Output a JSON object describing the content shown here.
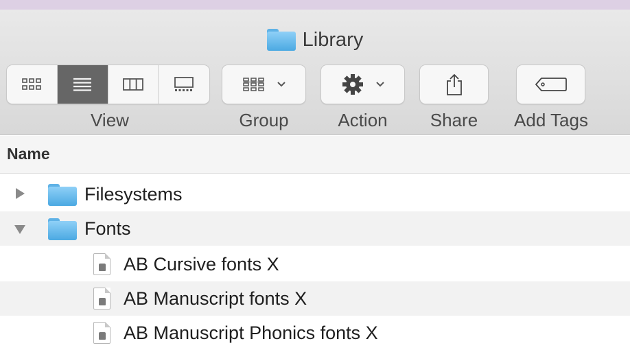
{
  "window": {
    "title": "Library",
    "title_icon": "folder-icon"
  },
  "toolbar": {
    "view": {
      "label": "View",
      "modes": [
        {
          "name": "icon-view",
          "icon": "grid-icon",
          "active": false
        },
        {
          "name": "list-view",
          "icon": "list-icon",
          "active": true
        },
        {
          "name": "column-view",
          "icon": "columns-icon",
          "active": false
        },
        {
          "name": "gallery-view",
          "icon": "gallery-icon",
          "active": false
        }
      ]
    },
    "group": {
      "label": "Group",
      "icon": "group-grid-icon"
    },
    "action": {
      "label": "Action",
      "icon": "gear-icon"
    },
    "share": {
      "label": "Share",
      "icon": "share-icon"
    },
    "add_tags": {
      "label": "Add Tags",
      "icon": "tag-icon"
    }
  },
  "list": {
    "column_header": "Name",
    "rows": [
      {
        "name": "Filesystems",
        "kind": "folder",
        "expanded": false,
        "depth": 0
      },
      {
        "name": "Fonts",
        "kind": "folder",
        "expanded": true,
        "depth": 0
      },
      {
        "name": "AB Cursive fonts X",
        "kind": "document",
        "depth": 1
      },
      {
        "name": "AB Manuscript fonts X",
        "kind": "document",
        "depth": 1
      },
      {
        "name": "AB Manuscript Phonics fonts X",
        "kind": "document",
        "depth": 1
      }
    ]
  },
  "colors": {
    "toolbar_bg": "#dedede",
    "folder_blue": "#5fb2e6",
    "active_segment": "#666666",
    "alt_row": "#f2f2f2"
  }
}
